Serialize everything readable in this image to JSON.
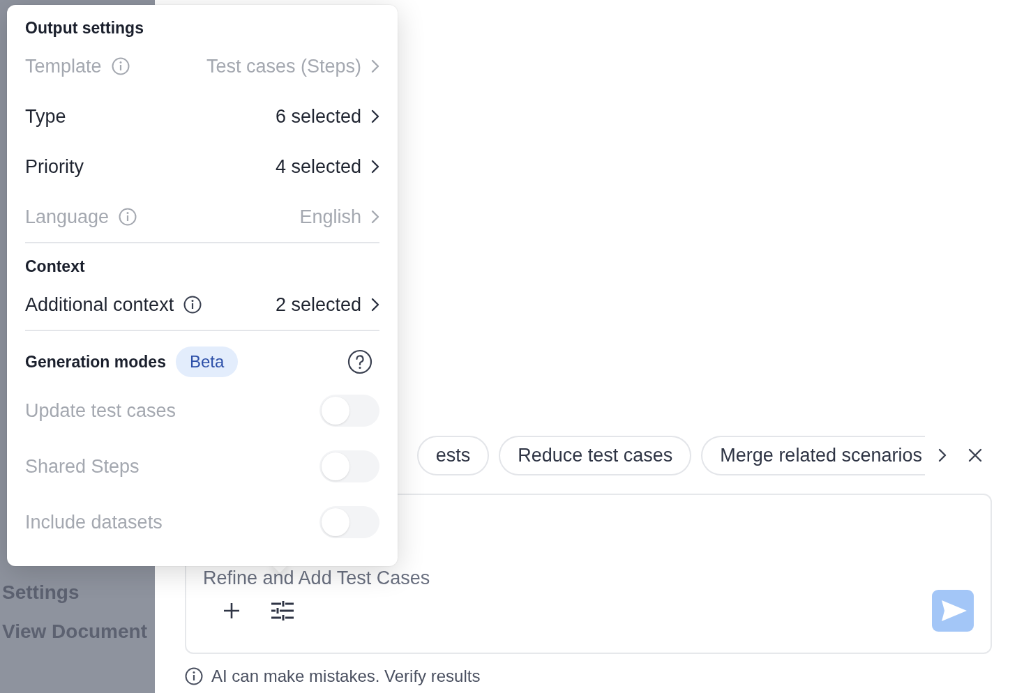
{
  "sidebar": {
    "items": [
      {
        "label": "Settings"
      },
      {
        "label": "View Document"
      }
    ]
  },
  "suggestions": {
    "chips": [
      "ests",
      "Reduce test cases",
      "Merge related scenarios"
    ]
  },
  "composer": {
    "placeholder": "Refine and Add Test Cases"
  },
  "disclaimer": "AI can make mistakes. Verify results",
  "popover": {
    "sections": [
      {
        "title": "Output settings",
        "rows": [
          {
            "label": "Template",
            "value": "Test cases (Steps)",
            "info": true,
            "disabled": true
          },
          {
            "label": "Type",
            "value": "6 selected",
            "info": false,
            "disabled": false
          },
          {
            "label": "Priority",
            "value": "4 selected",
            "info": false,
            "disabled": false
          },
          {
            "label": "Language",
            "value": "English",
            "info": true,
            "disabled": true
          }
        ]
      },
      {
        "title": "Context",
        "rows": [
          {
            "label": "Additional context",
            "value": "2 selected",
            "info": true,
            "disabled": false
          }
        ]
      }
    ],
    "modes": {
      "title": "Generation modes",
      "badge": "Beta",
      "toggles": [
        {
          "label": "Update test cases",
          "on": false,
          "disabled": true
        },
        {
          "label": "Shared Steps",
          "on": false,
          "disabled": true
        },
        {
          "label": "Include datasets",
          "on": false,
          "disabled": true
        }
      ]
    }
  }
}
